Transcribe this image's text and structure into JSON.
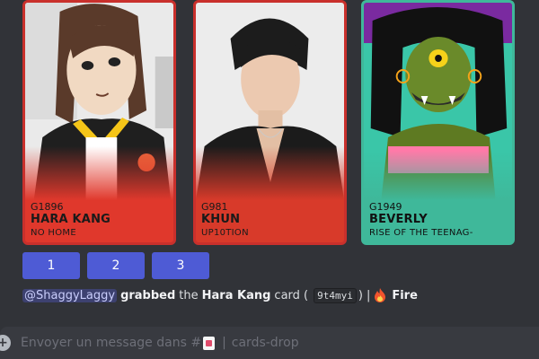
{
  "cards": [
    {
      "code": "G1896",
      "name": "HARA KANG",
      "series": "NO HOME"
    },
    {
      "code": "G981",
      "name": "KHUN",
      "series": "UP10TION"
    },
    {
      "code": "G1949",
      "name": "BEVERLY",
      "series": "RISE OF THE TEENAG-"
    }
  ],
  "buttons": [
    "1",
    "2",
    "3"
  ],
  "message": {
    "mention": "@ShaggyLaggy",
    "action": "grabbed",
    "the_word": "the",
    "card_name": "Hara Kang",
    "card_word": "card (",
    "card_code": "9t4myi",
    "close_paren": ")",
    "separator": "|",
    "condition": "Fire"
  },
  "composer": {
    "placeholder_prefix": "Envoyer un message dans #",
    "divider": "|",
    "channel": "cards-drop"
  },
  "colors": {
    "accent": "#4e5bd5",
    "card1": "#e0382c",
    "card2": "#d83a2a",
    "card3": "#3fb89a"
  }
}
